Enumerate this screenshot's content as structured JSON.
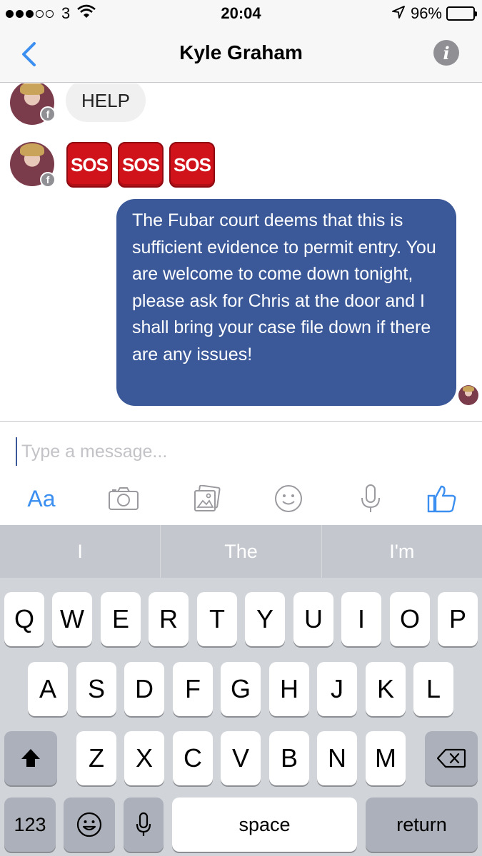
{
  "status_bar": {
    "carrier": "3",
    "time": "20:04",
    "battery": "96%",
    "battery_level": 0.96,
    "signal_bars_filled": 3,
    "signal_bars_total": 5
  },
  "nav": {
    "title": "Kyle Graham",
    "info_glyph": "i"
  },
  "messages": {
    "incoming_text": "HELP",
    "badge_glyph": "f",
    "sos": [
      "SOS",
      "SOS",
      "SOS"
    ],
    "outgoing_text": "The Fubar court deems that this is sufficient evidence to permit entry. You are welcome to come down tonight, please ask for Chris at the door and I shall bring your case file down if there are any issues!"
  },
  "composer": {
    "placeholder": "Type a message...",
    "aa_label": "Aa",
    "accent": "#3b8ff0"
  },
  "keyboard": {
    "predictions": [
      "I",
      "The",
      "I'm"
    ],
    "row1": [
      "Q",
      "W",
      "E",
      "R",
      "T",
      "Y",
      "U",
      "I",
      "O",
      "P"
    ],
    "row2": [
      "A",
      "S",
      "D",
      "F",
      "G",
      "H",
      "J",
      "K",
      "L"
    ],
    "row3": [
      "Z",
      "X",
      "C",
      "V",
      "B",
      "N",
      "M"
    ],
    "numbers_label": "123",
    "space_label": "space",
    "return_label": "return"
  },
  "colors": {
    "outgoing_bubble": "#3b5998",
    "incoming_bubble": "#f0f0f0",
    "sos_red": "#d0121b"
  }
}
